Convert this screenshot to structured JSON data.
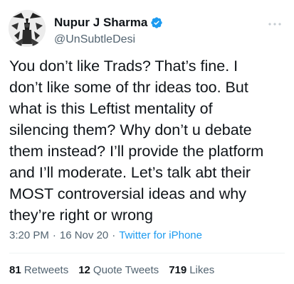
{
  "author": {
    "display_name": "Nupur J Sharma",
    "handle": "@UnSubtleDesi",
    "verified_icon": "verified-badge-icon",
    "avatar": "profile-avatar"
  },
  "tweet": {
    "text": "You don’t like Trads? That’s fine. I\ndon’t like some of thr ideas too. But\nwhat is this Leftist mentality of\nsilencing them? Why don’t u debate\nthem instead? I’ll provide the platform\nand I’ll moderate. Let’s talk abt their\nMOST controversial ideas and why\nthey’re right or wrong",
    "time": "3:20 PM",
    "date": "16 Nov 20",
    "source": "Twitter for iPhone",
    "separator": "·"
  },
  "stats": {
    "retweets_count": "81",
    "retweets_label": "Retweets",
    "quote_count": "12",
    "quote_label": "Quote Tweets",
    "likes_count": "719",
    "likes_label": "Likes"
  },
  "colors": {
    "accent": "#1d9bf0",
    "text": "#0f1419",
    "secondary": "#536471"
  }
}
